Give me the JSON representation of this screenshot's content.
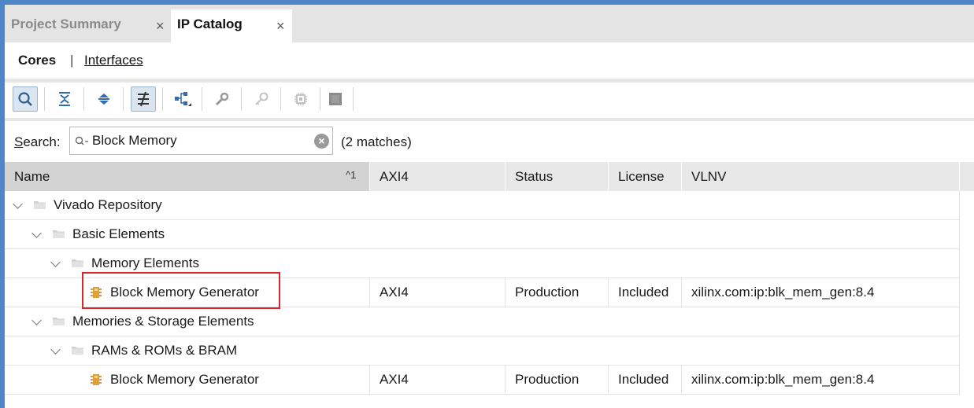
{
  "tabs": [
    {
      "label": "Project Summary",
      "close": "×",
      "active": false
    },
    {
      "label": "IP Catalog",
      "close": "×",
      "active": true
    }
  ],
  "subtabs": {
    "cores": "Cores",
    "separator": "|",
    "interfaces": "Interfaces"
  },
  "toolbar": {
    "icons": [
      "search-icon",
      "collapse-all-icon",
      "expand-all-icon",
      "filter-icon",
      "hierarchy-icon",
      "customize-wrench-icon",
      "key-icon",
      "chip-icon",
      "block-icon"
    ]
  },
  "search": {
    "label_accel": "S",
    "label_rest": "earch:",
    "value": "Block Memory",
    "matches": "(2 matches)"
  },
  "columns": {
    "name": "Name",
    "sort_indicator": "^1",
    "axi4": "AXI4",
    "status": "Status",
    "license": "License",
    "vlnv": "VLNV"
  },
  "rows": [
    {
      "type": "folder",
      "label": "Vivado Repository"
    },
    {
      "type": "folder",
      "label": "Basic Elements"
    },
    {
      "type": "folder",
      "label": "Memory Elements"
    },
    {
      "type": "ip",
      "label": "Block Memory Generator",
      "axi4": "AXI4",
      "status": "Production",
      "license": "Included",
      "vlnv": "xilinx.com:ip:blk_mem_gen:8.4"
    },
    {
      "type": "folder",
      "label": "Memories & Storage Elements"
    },
    {
      "type": "folder",
      "label": "RAMs & ROMs & BRAM"
    },
    {
      "type": "ip",
      "label": "Block Memory Generator",
      "axi4": "AXI4",
      "status": "Production",
      "license": "Included",
      "vlnv": "xilinx.com:ip:blk_mem_gen:8.4"
    }
  ],
  "colors": {
    "accent": "#4e86c8",
    "highlight": "#d9262a",
    "ip_icon": "#e0a13a"
  }
}
